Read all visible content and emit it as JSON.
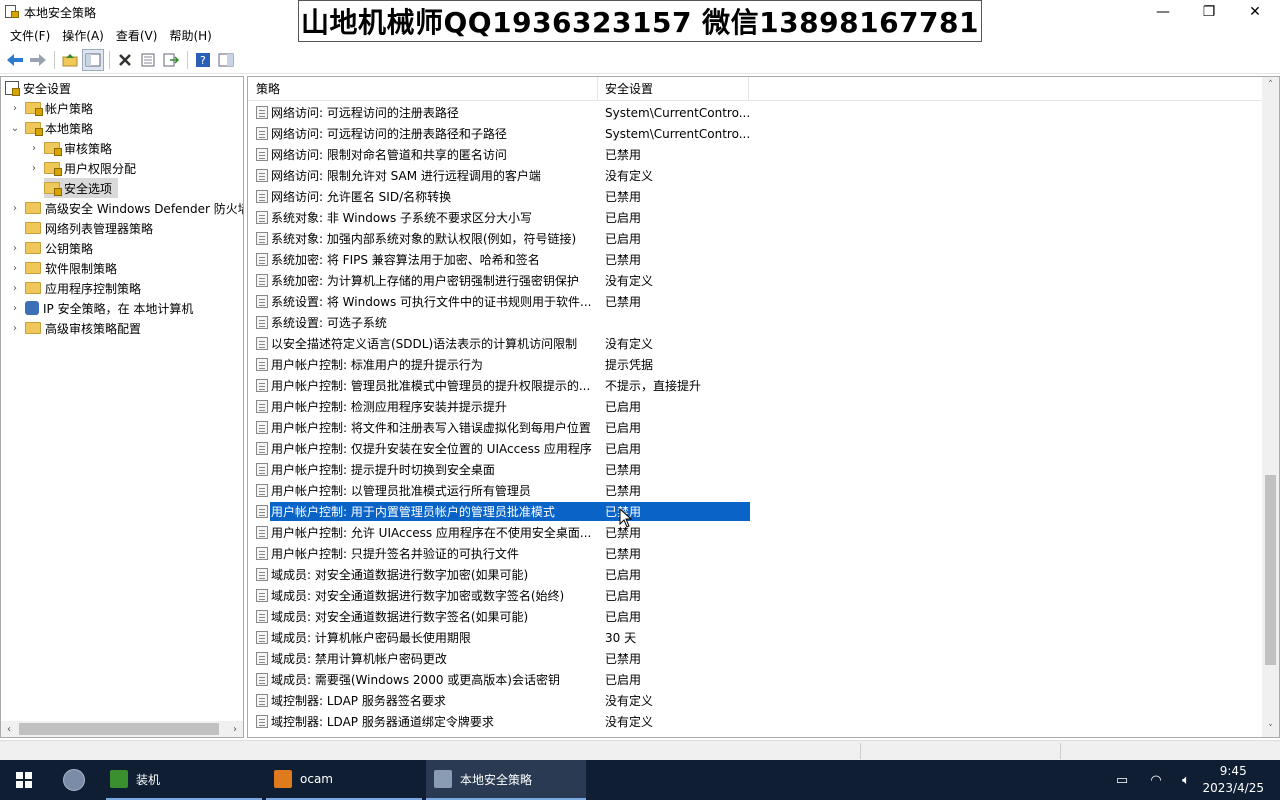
{
  "window": {
    "title": "本地安全策略",
    "banner": "山地机械师QQ1936323157 微信13898167781",
    "minimize": "—",
    "maximize": "❐",
    "close": "✕"
  },
  "menu": [
    "文件(F)",
    "操作(A)",
    "查看(V)",
    "帮助(H)"
  ],
  "tree": {
    "root": "安全设置",
    "items": [
      {
        "label": "帐户策略",
        "level": 1,
        "expanded": false,
        "lock": true
      },
      {
        "label": "本地策略",
        "level": 1,
        "expanded": true,
        "lock": true
      },
      {
        "label": "审核策略",
        "level": 2,
        "expanded": false,
        "lock": true
      },
      {
        "label": "用户权限分配",
        "level": 2,
        "expanded": false,
        "lock": true
      },
      {
        "label": "安全选项",
        "level": 2,
        "expanded": null,
        "lock": true,
        "selected": true
      },
      {
        "label": "高级安全 Windows Defender 防火墙",
        "level": 1,
        "expanded": false,
        "lock": false
      },
      {
        "label": "网络列表管理器策略",
        "level": 1,
        "expanded": null,
        "lock": false
      },
      {
        "label": "公钥策略",
        "level": 1,
        "expanded": false,
        "lock": false
      },
      {
        "label": "软件限制策略",
        "level": 1,
        "expanded": false,
        "lock": false
      },
      {
        "label": "应用程序控制策略",
        "level": 1,
        "expanded": false,
        "lock": false
      },
      {
        "label": "IP 安全策略，在 本地计算机",
        "level": 1,
        "expanded": false,
        "lock": false,
        "ip": true
      },
      {
        "label": "高级审核策略配置",
        "level": 1,
        "expanded": false,
        "lock": false
      }
    ]
  },
  "list": {
    "col_policy": "策略",
    "col_setting": "安全设置",
    "rows": [
      {
        "policy": "网络访问: 可远程访问的注册表路径",
        "setting": "System\\CurrentContro..."
      },
      {
        "policy": "网络访问: 可远程访问的注册表路径和子路径",
        "setting": "System\\CurrentContro..."
      },
      {
        "policy": "网络访问: 限制对命名管道和共享的匿名访问",
        "setting": "已禁用"
      },
      {
        "policy": "网络访问: 限制允许对 SAM 进行远程调用的客户端",
        "setting": "没有定义"
      },
      {
        "policy": "网络访问: 允许匿名 SID/名称转换",
        "setting": "已禁用"
      },
      {
        "policy": "系统对象: 非 Windows 子系统不要求区分大小写",
        "setting": "已启用"
      },
      {
        "policy": "系统对象: 加强内部系统对象的默认权限(例如，符号链接)",
        "setting": "已启用"
      },
      {
        "policy": "系统加密: 将 FIPS 兼容算法用于加密、哈希和签名",
        "setting": "已禁用"
      },
      {
        "policy": "系统加密: 为计算机上存储的用户密钥强制进行强密钥保护",
        "setting": "没有定义"
      },
      {
        "policy": "系统设置: 将 Windows 可执行文件中的证书规则用于软件...",
        "setting": "已禁用"
      },
      {
        "policy": "系统设置: 可选子系统",
        "setting": ""
      },
      {
        "policy": "以安全描述符定义语言(SDDL)语法表示的计算机访问限制",
        "setting": "没有定义"
      },
      {
        "policy": "用户帐户控制: 标准用户的提升提示行为",
        "setting": "提示凭据"
      },
      {
        "policy": "用户帐户控制: 管理员批准模式中管理员的提升权限提示的...",
        "setting": "不提示，直接提升"
      },
      {
        "policy": "用户帐户控制: 检测应用程序安装并提示提升",
        "setting": "已启用"
      },
      {
        "policy": "用户帐户控制: 将文件和注册表写入错误虚拟化到每用户位置",
        "setting": "已启用"
      },
      {
        "policy": "用户帐户控制: 仅提升安装在安全位置的 UIAccess 应用程序",
        "setting": "已启用"
      },
      {
        "policy": "用户帐户控制: 提示提升时切换到安全桌面",
        "setting": "已禁用"
      },
      {
        "policy": "用户帐户控制: 以管理员批准模式运行所有管理员",
        "setting": "已禁用"
      },
      {
        "policy": "用户帐户控制: 用于内置管理员帐户的管理员批准模式",
        "setting": "已禁用",
        "selected": true
      },
      {
        "policy": "用户帐户控制: 允许 UIAccess 应用程序在不使用安全桌面...",
        "setting": "已禁用"
      },
      {
        "policy": "用户帐户控制: 只提升签名并验证的可执行文件",
        "setting": "已禁用"
      },
      {
        "policy": "域成员: 对安全通道数据进行数字加密(如果可能)",
        "setting": "已启用"
      },
      {
        "policy": "域成员: 对安全通道数据进行数字加密或数字签名(始终)",
        "setting": "已启用"
      },
      {
        "policy": "域成员: 对安全通道数据进行数字签名(如果可能)",
        "setting": "已启用"
      },
      {
        "policy": "域成员: 计算机帐户密码最长使用期限",
        "setting": "30 天"
      },
      {
        "policy": "域成员: 禁用计算机帐户密码更改",
        "setting": "已禁用"
      },
      {
        "policy": "域成员: 需要强(Windows 2000 或更高版本)会话密钥",
        "setting": "已启用"
      },
      {
        "policy": "域控制器: LDAP 服务器签名要求",
        "setting": "没有定义"
      },
      {
        "policy": "域控制器: LDAP 服务器通道绑定令牌要求",
        "setting": "没有定义"
      }
    ]
  },
  "taskbar": {
    "apps": [
      {
        "label": "装机",
        "color": "#3a8f2e"
      },
      {
        "label": "ocam",
        "color": "#e07a1e"
      },
      {
        "label": "本地安全策略",
        "color": "#8a9bb4"
      }
    ],
    "time": "9:45",
    "date": "2023/4/25"
  }
}
